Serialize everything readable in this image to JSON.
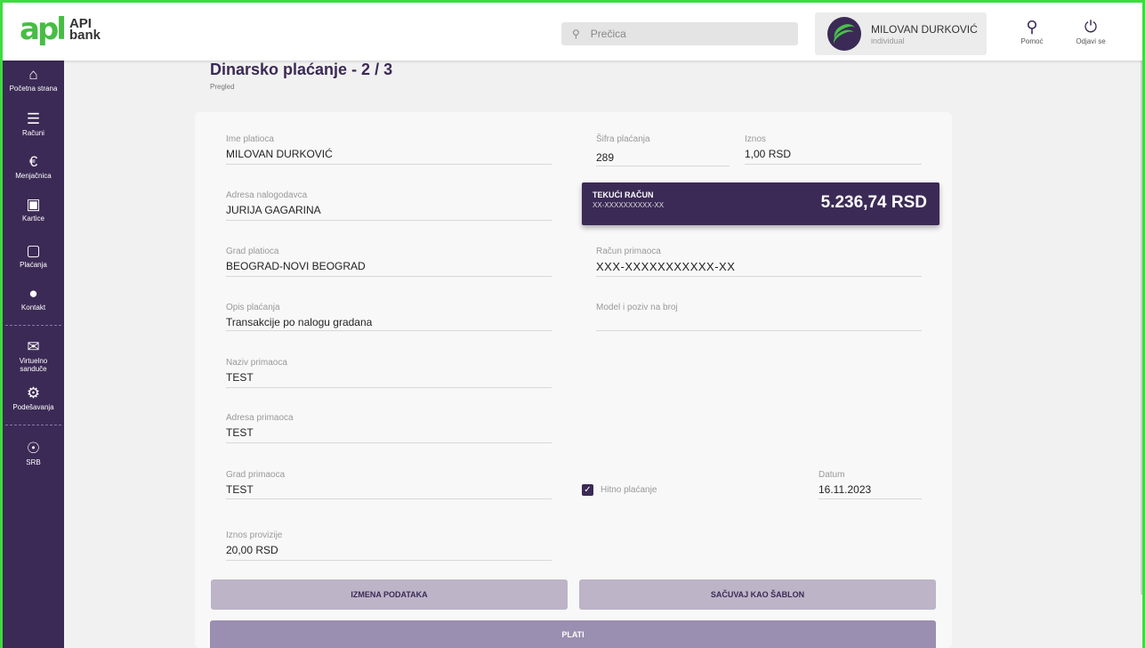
{
  "brand": {
    "mark": "apl",
    "line1": "API",
    "line2": "bank",
    "accent": "#47bd45",
    "primary": "#3b2a55"
  },
  "search": {
    "placeholder": "Prečica",
    "icon": "search-icon"
  },
  "user": {
    "name": "MILOVAN DURKOVIĆ",
    "type": "individual"
  },
  "top_actions": [
    {
      "label": "Pomoć",
      "icon": "help-icon"
    },
    {
      "label": "Odjavi se",
      "icon": "power-icon"
    }
  ],
  "sidebar": {
    "items": [
      {
        "label": "Početna strana",
        "icon": "home-icon"
      },
      {
        "label": "Računi",
        "icon": "list-icon"
      },
      {
        "label": "Menjačnica",
        "icon": "exchange-icon"
      },
      {
        "label": "Kartice",
        "icon": "card-icon"
      },
      {
        "label": "Plaćanja",
        "icon": "wallet-icon"
      },
      {
        "label": "Kontakt",
        "icon": "chat-icon"
      },
      {
        "label": "Virtuelno sanduče",
        "icon": "mail-icon"
      },
      {
        "label": "Podešavanja",
        "icon": "gear-icon"
      },
      {
        "label": "SRB",
        "icon": "globe-icon"
      }
    ]
  },
  "page": {
    "title": "Dinarsko plaćanje - 2 / 3",
    "subtitle": "Pregled"
  },
  "form": {
    "ime_platioca": {
      "label": "Ime platioca",
      "value": "MILOVAN DURKOVIĆ"
    },
    "sifra_placanja": {
      "label": "Šifra plaćanja",
      "value": "289"
    },
    "iznos": {
      "label": "Iznos",
      "value": "1,00 RSD"
    },
    "adresa_nalogodavca": {
      "label": "Adresa nalogodavca",
      "value": "JURIJA GAGARINA"
    },
    "grad_platioca": {
      "label": "Grad platioca",
      "value": "BEOGRAD-NOVI BEOGRAD"
    },
    "racun_primaoca": {
      "label": "Račun primaoca",
      "value": "XXX-XXXXXXXXXXX-XX"
    },
    "opis_placanja": {
      "label": "Opis plaćanja",
      "value": "Transakcije po nalogu gradana"
    },
    "model_poziv": {
      "label": "Model i poziv na broj",
      "value": ""
    },
    "naziv_primaoca": {
      "label": "Naziv primaoca",
      "value": "TEST"
    },
    "adresa_primaoca": {
      "label": "Adresa primaoca",
      "value": "TEST"
    },
    "grad_primaoca": {
      "label": "Grad primaoca",
      "value": "TEST"
    },
    "datum": {
      "label": "Datum",
      "value": "16.11.2023"
    },
    "iznos_provizije": {
      "label": "Iznos provizije",
      "value": "20,00 RSD"
    }
  },
  "account": {
    "title": "TEKUĆI RAČUN",
    "number": "XX-XXXXXXXXXX-XX",
    "balance": "5.236,74 RSD"
  },
  "urgent": {
    "label": "Hitno plaćanje",
    "checked": true
  },
  "buttons": {
    "edit": "IZMENA PODATAKA",
    "save_template": "SAČUVAJ KAO ŠABLON",
    "pay": "PLATI"
  }
}
